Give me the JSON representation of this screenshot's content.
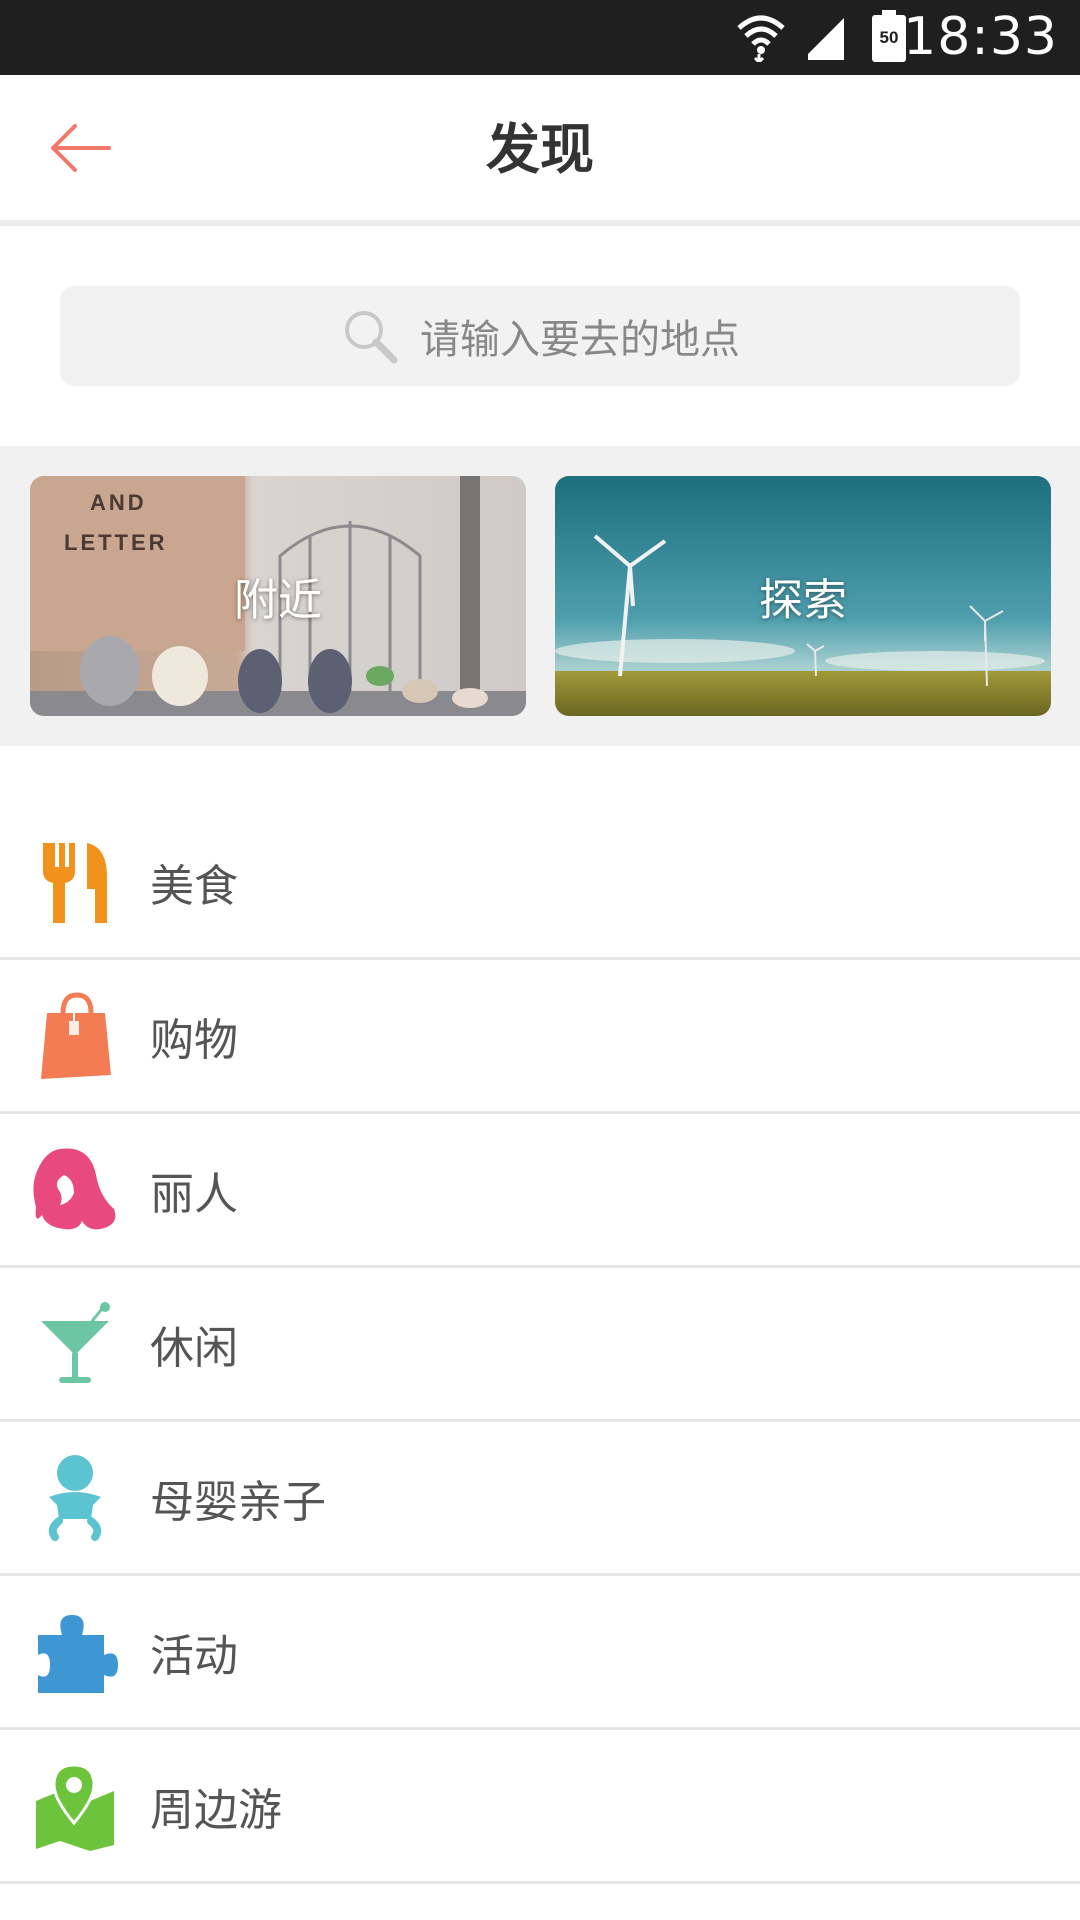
{
  "status_bar": {
    "time": "18:33",
    "battery": "50"
  },
  "header": {
    "title": "发现"
  },
  "search": {
    "placeholder": "请输入要去的地点"
  },
  "banners": [
    {
      "label": "附近",
      "photo_text_line1": "AND",
      "photo_text_line2": "LETTER"
    },
    {
      "label": "探索"
    }
  ],
  "categories": [
    {
      "label": "美食",
      "icon": "fork-knife-icon",
      "color": "#f0921b"
    },
    {
      "label": "购物",
      "icon": "shopping-bag-icon",
      "color": "#f47c55"
    },
    {
      "label": "丽人",
      "icon": "woman-hair-icon",
      "color": "#e84a7f"
    },
    {
      "label": "休闲",
      "icon": "cocktail-icon",
      "color": "#6cc6a4"
    },
    {
      "label": "母婴亲子",
      "icon": "baby-icon",
      "color": "#5bc4d0"
    },
    {
      "label": "活动",
      "icon": "puzzle-icon",
      "color": "#3e96d2"
    },
    {
      "label": "周边游",
      "icon": "map-pin-icon",
      "color": "#6cc43c"
    }
  ]
}
